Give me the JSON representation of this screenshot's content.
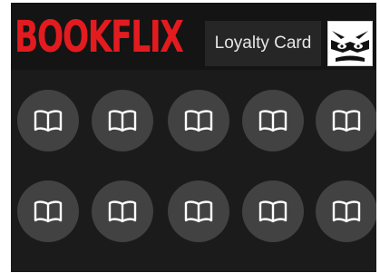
{
  "header": {
    "brand": "BOOKFLIX",
    "title": "Loyalty Card",
    "mascot_icon": "masked-character-icon"
  },
  "stamps": {
    "icon": "open-book-icon",
    "rows": 2,
    "columns": 5,
    "total": 10,
    "filled": 0
  },
  "colors": {
    "brand": "#e31b1f",
    "card_background": "#1b1b1b",
    "header_background": "#141414",
    "stamp_circle": "#424242",
    "stamp_icon": "#ffffff"
  }
}
